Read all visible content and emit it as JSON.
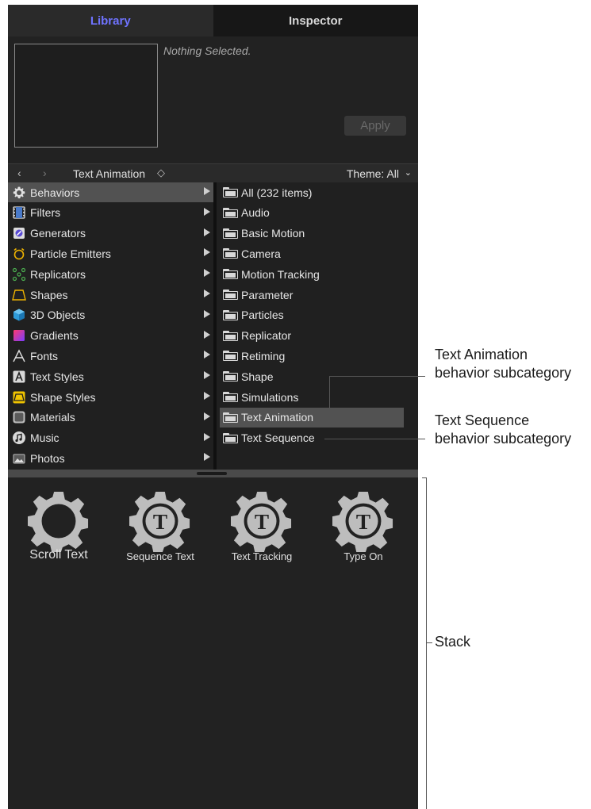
{
  "tabs": {
    "library": "Library",
    "inspector": "Inspector"
  },
  "preview": {
    "status": "Nothing Selected.",
    "apply_label": "Apply"
  },
  "nav": {
    "back": "‹",
    "forward": "›",
    "title": "Text Animation",
    "title_chevron": "◇",
    "theme": "Theme: All",
    "theme_chevron": "⌄"
  },
  "categories": [
    {
      "label": "Behaviors",
      "icon": "gear-icon",
      "selected": true
    },
    {
      "label": "Filters",
      "icon": "film-icon"
    },
    {
      "label": "Generators",
      "icon": "generator-icon"
    },
    {
      "label": "Particle Emitters",
      "icon": "alarm-icon"
    },
    {
      "label": "Replicators",
      "icon": "replicator-icon"
    },
    {
      "label": "Shapes",
      "icon": "trapezoid-icon"
    },
    {
      "label": "3D Objects",
      "icon": "cube-icon"
    },
    {
      "label": "Gradients",
      "icon": "gradient-icon"
    },
    {
      "label": "Fonts",
      "icon": "font-icon"
    },
    {
      "label": "Text Styles",
      "icon": "text-style-icon"
    },
    {
      "label": "Shape Styles",
      "icon": "shape-style-icon"
    },
    {
      "label": "Materials",
      "icon": "materials-icon"
    },
    {
      "label": "Music",
      "icon": "music-icon"
    },
    {
      "label": "Photos",
      "icon": "photos-icon"
    }
  ],
  "subcategories": [
    {
      "label": "All (232 items)"
    },
    {
      "label": "Audio"
    },
    {
      "label": "Basic Motion"
    },
    {
      "label": "Camera"
    },
    {
      "label": "Motion Tracking"
    },
    {
      "label": "Parameter"
    },
    {
      "label": "Particles"
    },
    {
      "label": "Replicator"
    },
    {
      "label": "Retiming"
    },
    {
      "label": "Shape"
    },
    {
      "label": "Simulations"
    },
    {
      "label": "Text Animation",
      "selected": true
    },
    {
      "label": "Text Sequence"
    }
  ],
  "stack": [
    {
      "label": "Scroll Text",
      "icon": "gear-icon"
    },
    {
      "label": "Sequence Text",
      "icon": "gear-text-icon",
      "glyph": "T"
    },
    {
      "label": "Text Tracking",
      "icon": "gear-text-icon",
      "glyph": "T"
    },
    {
      "label": "Type On",
      "icon": "gear-text-icon",
      "glyph": "T"
    }
  ],
  "callouts": {
    "text_animation": [
      "Text Animation",
      "behavior subcategory"
    ],
    "text_sequence": [
      "Text Sequence",
      "behavior subcategory"
    ],
    "stack": "Stack"
  },
  "colors": {
    "panel": "#202020",
    "selected_row": "#525252",
    "library_tab": "#6f73ff"
  }
}
